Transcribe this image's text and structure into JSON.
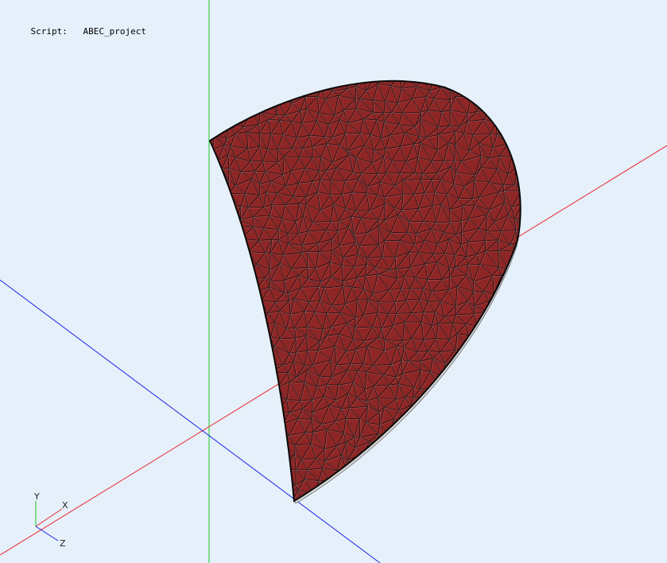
{
  "header": {
    "script_label": "Script:",
    "script_value": "ABEC_project"
  },
  "axes": {
    "x_color": "#e8262a",
    "y_color": "#19c81e",
    "z_color": "#1a24e6"
  },
  "gizmo": {
    "x_label": "X",
    "y_label": "Y",
    "z_label": "Z",
    "x_color": "#e8262a",
    "y_color": "#19c81e",
    "z_color": "#1a24e6"
  },
  "mesh": {
    "fill_color": "#8e2626",
    "edge_color": "#0a0a0a"
  },
  "background_color": "#e6f0fb"
}
